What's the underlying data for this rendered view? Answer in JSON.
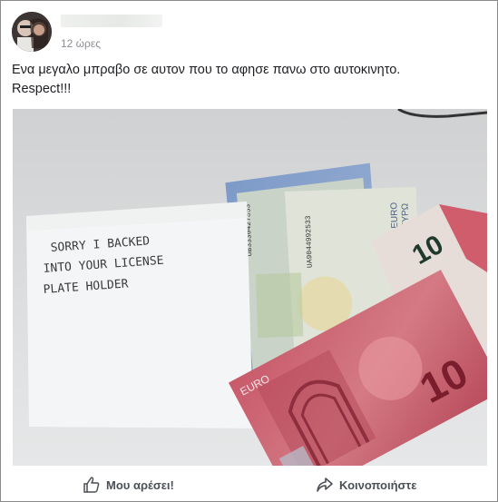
{
  "post": {
    "timestamp": "12 ώρες",
    "text_line1": "Ενα μεγαλο μπραβο σε αυτον που το αφησε πανω στο αυτοκινητο.",
    "text_line2": "Respect!!!"
  },
  "photo": {
    "note_line1": "SORRY I BACKED",
    "note_line2": "INTO YOUR LICENSE",
    "note_line3": "PLATE HOLDER",
    "bill_serial_1": "UB3330427853",
    "bill_serial_2": "UA9044992533",
    "bill_brand": "EURO",
    "bill_brand_greek": "EYPΩ",
    "bill_value": "10"
  },
  "actions": {
    "like_label": "Μου αρέσει!",
    "like_icon": "thumbs-up-icon",
    "share_label": "Κοινοποιήστε",
    "share_icon": "share-arrow-icon"
  }
}
